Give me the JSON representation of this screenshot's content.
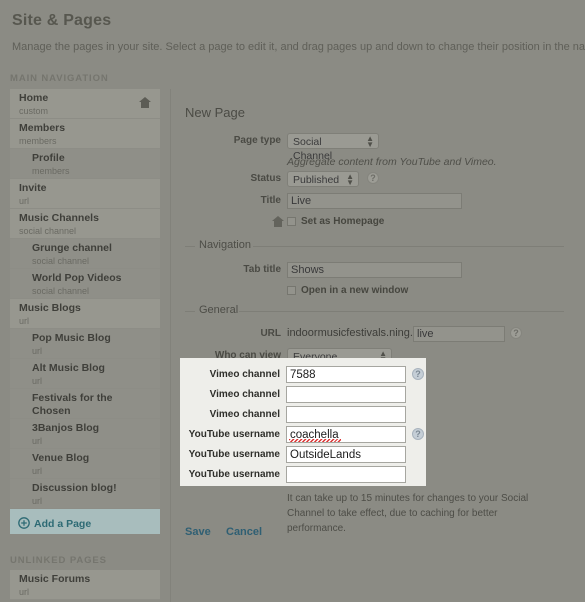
{
  "header": {
    "title": "Site & Pages",
    "description": "Manage the pages in your site. Select a page to edit it, and drag pages up and down to change their position in the navigation menu.",
    "main_nav_label": "MAIN NAVIGATION",
    "unlinked_label": "UNLINKED PAGES"
  },
  "sidebar": {
    "items": [
      {
        "title": "Home",
        "subtitle": "custom",
        "sub": false,
        "home_icon": true
      },
      {
        "title": "Members",
        "subtitle": "members",
        "sub": false,
        "home_icon": false
      },
      {
        "title": "Profile",
        "subtitle": "members",
        "sub": true,
        "home_icon": false
      },
      {
        "title": "Invite",
        "subtitle": "url",
        "sub": false,
        "home_icon": false
      },
      {
        "title": "Music Channels",
        "subtitle": "social channel",
        "sub": false,
        "home_icon": false
      },
      {
        "title": "Grunge channel",
        "subtitle": "social channel",
        "sub": true,
        "home_icon": false
      },
      {
        "title": "World Pop Videos",
        "subtitle": "social channel",
        "sub": true,
        "home_icon": false
      },
      {
        "title": "Music Blogs",
        "subtitle": "url",
        "sub": false,
        "home_icon": false
      },
      {
        "title": "Pop Music Blog",
        "subtitle": "url",
        "sub": true,
        "home_icon": false
      },
      {
        "title": "Alt Music Blog",
        "subtitle": "url",
        "sub": true,
        "home_icon": false
      },
      {
        "title": "Festivals for the Chosen",
        "subtitle": "url",
        "sub": true,
        "home_icon": false
      },
      {
        "title": "3Banjos Blog",
        "subtitle": "url",
        "sub": true,
        "home_icon": false
      },
      {
        "title": "Venue Blog",
        "subtitle": "url",
        "sub": true,
        "home_icon": false
      },
      {
        "title": "Discussion blog!",
        "subtitle": "url",
        "sub": true,
        "home_icon": false
      }
    ],
    "add_page_label": "Add a Page",
    "add_page_icon": "plus-circle-icon",
    "unlinked_items": [
      {
        "title": "Music Forums",
        "subtitle": "url",
        "sub": false,
        "home_icon": false
      }
    ]
  },
  "form": {
    "heading": "New Page",
    "page_type_label": "Page type",
    "page_type_value": "Social Channel",
    "page_type_hint": "Aggregate content from YouTube and Vimeo.",
    "status_label": "Status",
    "status_value": "Published",
    "title_label": "Title",
    "title_value": "Live",
    "set_homepage_label": "Set as Homepage",
    "set_homepage_checked": false,
    "navigation_legend": "Navigation",
    "tab_title_label": "Tab title",
    "tab_title_value": "Shows",
    "new_window_label": "Open in a new window",
    "new_window_checked": false,
    "general_legend": "General",
    "url_label": "URL",
    "url_prefix": "indoormusicfestivals.ning.com/",
    "url_value": "live",
    "who_can_view_label": "Who can view",
    "who_can_view_value": "Everyone (Public)",
    "note": "It can take up to 15 minutes for changes to your Social Channel to take effect, due to caching for better performance.",
    "save_label": "Save",
    "cancel_label": "Cancel",
    "help_icon": "question-mark-icon",
    "select_arrows_icon": "updown-arrows-icon"
  },
  "spotlight": {
    "fields": [
      {
        "label": "Vimeo channel",
        "value": "7588",
        "help": true,
        "misspelled": false
      },
      {
        "label": "Vimeo channel",
        "value": "",
        "help": false,
        "misspelled": false
      },
      {
        "label": "Vimeo channel",
        "value": "",
        "help": false,
        "misspelled": false
      },
      {
        "label": "YouTube username",
        "value": "coachella",
        "help": true,
        "misspelled": true
      },
      {
        "label": "YouTube username",
        "value": "OutsideLands",
        "help": false,
        "misspelled": false
      },
      {
        "label": "YouTube username",
        "value": "",
        "help": false,
        "misspelled": false
      }
    ]
  },
  "colors": {
    "dim_background": "#8b8b84",
    "spotlight_background": "#eeeeea",
    "add_page_background": "#a8bdbd",
    "link_color": "#2f5f73",
    "spellcheck_underline": "#dd3333"
  }
}
